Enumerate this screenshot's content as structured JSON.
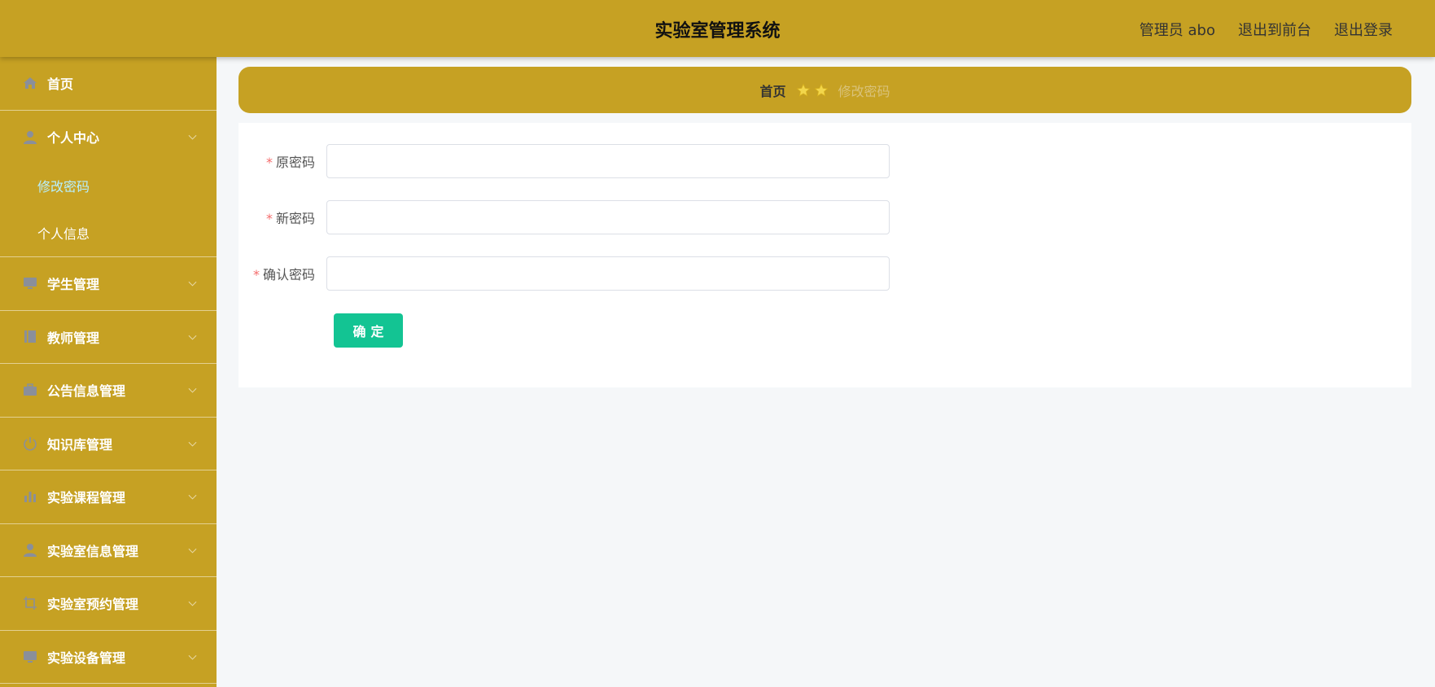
{
  "header": {
    "title": "实验室管理系统",
    "user_label": "管理员 abo",
    "front_link": "退出到前台",
    "logout_link": "退出登录"
  },
  "sidebar": {
    "items": [
      {
        "label": "首页",
        "icon": "home-icon"
      },
      {
        "label": "个人中心",
        "icon": "user-icon",
        "children": [
          {
            "label": "修改密码",
            "active": true
          },
          {
            "label": "个人信息",
            "active": false
          }
        ]
      },
      {
        "label": "学生管理",
        "icon": "monitor-icon"
      },
      {
        "label": "教师管理",
        "icon": "book-icon"
      },
      {
        "label": "公告信息管理",
        "icon": "briefcase-icon"
      },
      {
        "label": "知识库管理",
        "icon": "power-icon"
      },
      {
        "label": "实验课程管理",
        "icon": "bar-chart-icon"
      },
      {
        "label": "实验室信息管理",
        "icon": "user-icon"
      },
      {
        "label": "实验室预约管理",
        "icon": "crop-icon"
      },
      {
        "label": "实验设备管理",
        "icon": "monitor-icon"
      }
    ]
  },
  "breadcrumb": {
    "home": "首页",
    "current": "修改密码"
  },
  "form": {
    "old_password_label": "原密码",
    "new_password_label": "新密码",
    "confirm_password_label": "确认密码",
    "required_mark": "*",
    "submit_label": "确定"
  },
  "colors": {
    "brand": "#c6a123",
    "submit": "#13c493",
    "required": "#f56c6c",
    "active_submenu": "#b8f0ff"
  }
}
